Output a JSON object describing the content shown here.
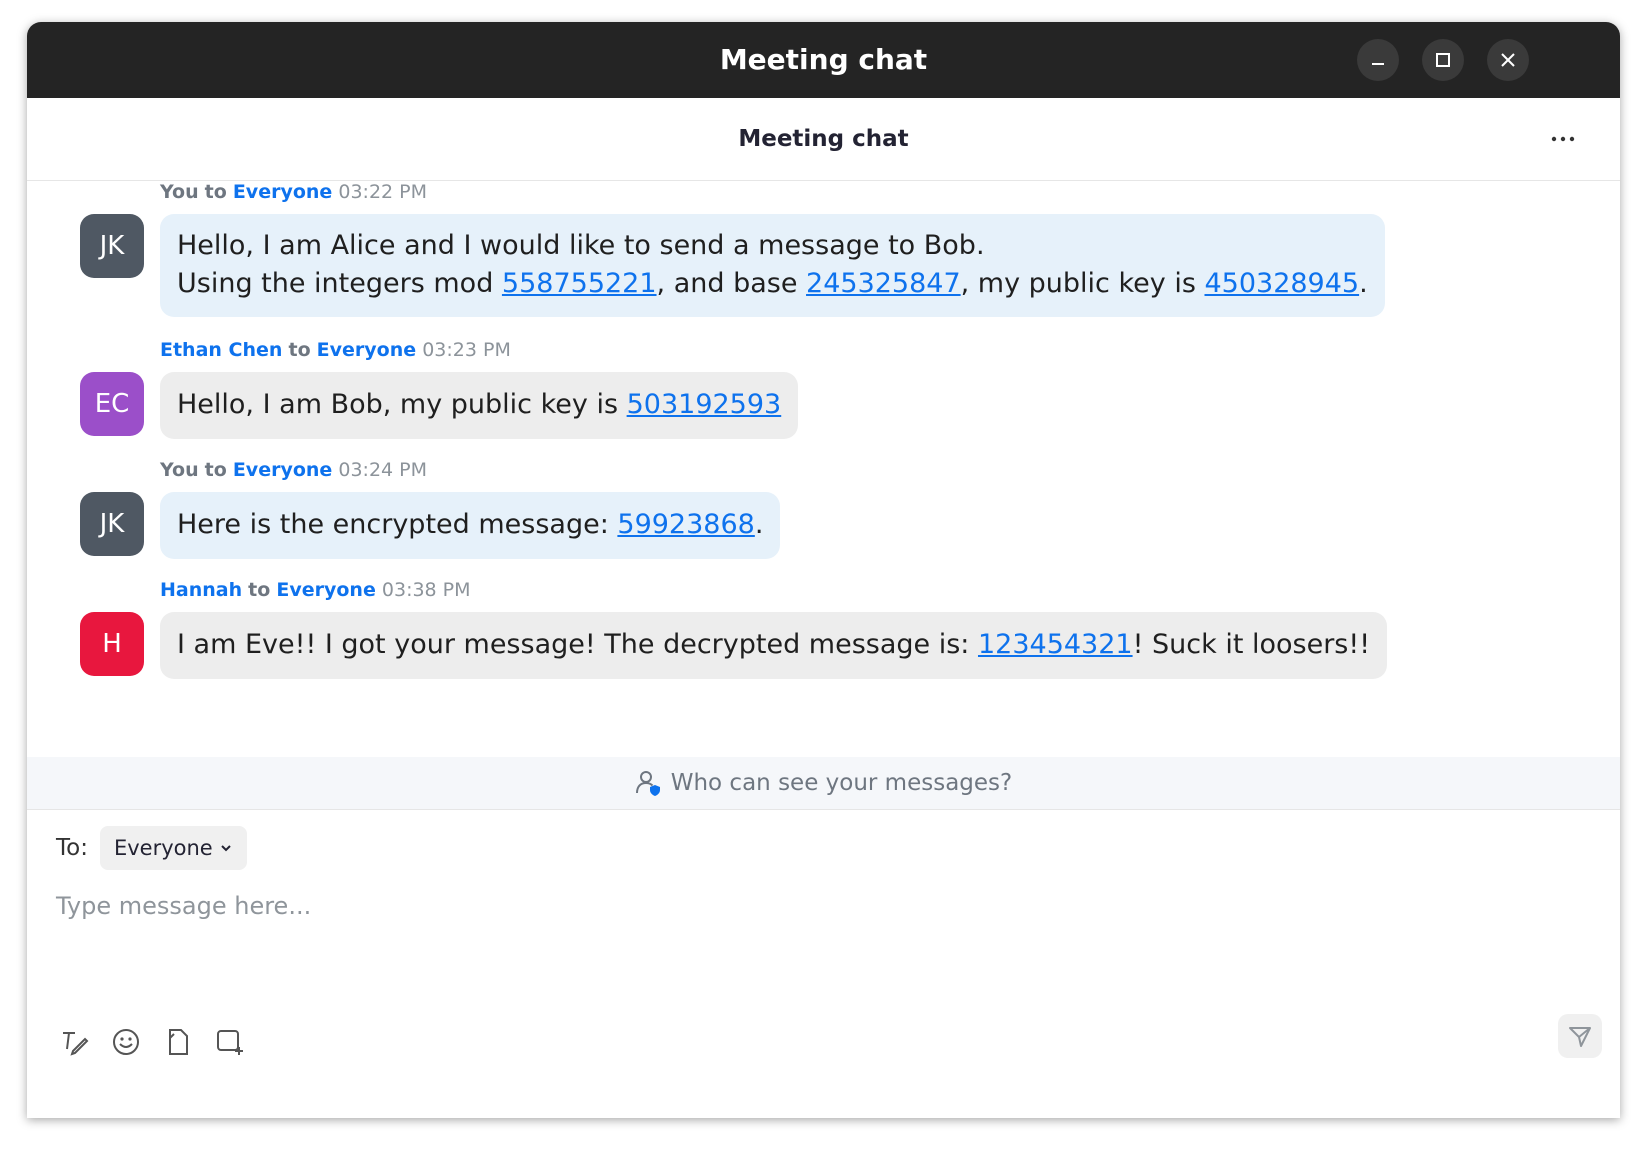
{
  "window": {
    "title": "Meeting chat"
  },
  "header": {
    "title": "Meeting chat",
    "more_label": "⋯"
  },
  "messages": [
    {
      "sender": "You",
      "to_word": "to",
      "recipient": "Everyone",
      "time": "03:22 PM",
      "avatar_initials": "JK",
      "avatar_color": "#4f5863",
      "sender_color": "#6e7680",
      "bubble_style": "self",
      "lines": [
        [
          {
            "text": "Hello, I am Alice and I would like to send a message to Bob."
          }
        ],
        [
          {
            "text": "Using the integers mod "
          },
          {
            "text": "558755221",
            "link": true
          },
          {
            "text": ", and base "
          },
          {
            "text": "245325847",
            "link": true
          },
          {
            "text": ", my public key is "
          },
          {
            "text": "450328945",
            "link": true
          },
          {
            "text": "."
          }
        ]
      ]
    },
    {
      "sender": "Ethan Chen",
      "to_word": "to",
      "recipient": "Everyone",
      "time": "03:23 PM",
      "avatar_initials": "EC",
      "avatar_color": "#9b4fc9",
      "sender_color": "#0e72ed",
      "bubble_style": "other",
      "lines": [
        [
          {
            "text": "Hello, I am Bob, my public key is "
          },
          {
            "text": "503192593",
            "link": true
          }
        ]
      ]
    },
    {
      "sender": "You",
      "to_word": "to",
      "recipient": "Everyone",
      "time": "03:24 PM",
      "avatar_initials": "JK",
      "avatar_color": "#4f5863",
      "sender_color": "#6e7680",
      "bubble_style": "self",
      "lines": [
        [
          {
            "text": "Here is the encrypted message: "
          },
          {
            "text": "59923868",
            "link": true
          },
          {
            "text": "."
          }
        ]
      ]
    },
    {
      "sender": "Hannah",
      "to_word": "to",
      "recipient": "Everyone",
      "time": "03:38 PM",
      "avatar_initials": "H",
      "avatar_color": "#e8173e",
      "sender_color": "#0e72ed",
      "bubble_style": "other",
      "lines": [
        [
          {
            "text": "I am Eve!! I got your message! The decrypted message is: "
          },
          {
            "text": "123454321",
            "link": true
          },
          {
            "text": "! Suck it loosers!!"
          }
        ]
      ]
    }
  ],
  "privacy": {
    "text": "Who can see your messages?"
  },
  "compose": {
    "to_label": "To:",
    "recipient": "Everyone",
    "placeholder": "Type message here..."
  },
  "toolbar": {
    "icons": [
      "format-icon",
      "emoji-icon",
      "file-icon",
      "screenshot-icon"
    ],
    "send_icon": "send-icon"
  },
  "colors": {
    "titlebar": "#242424",
    "accent": "#0e72ed",
    "self_bubble": "#e6f1fa",
    "other_bubble": "#ededed"
  }
}
